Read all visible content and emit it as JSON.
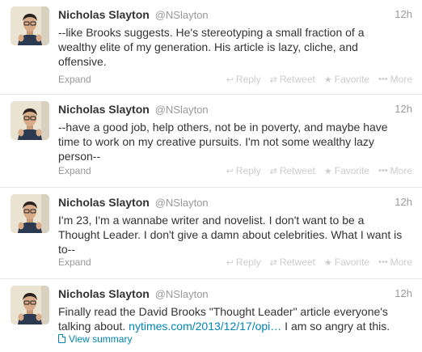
{
  "tweets": [
    {
      "name": "Nicholas Slayton",
      "handle": "@NSlayton",
      "time": "12h",
      "lines": [
        "--like Brooks suggests. He's stereotyping a small fraction of a",
        "wealthy elite of my generation. His article is lazy, cliche, and",
        "offensive."
      ],
      "expand": "Expand"
    },
    {
      "name": "Nicholas Slayton",
      "handle": "@NSlayton",
      "time": "12h",
      "lines": [
        "--have a good job, help others, not be in poverty, and maybe have",
        "time to work on my creative pursuits. I'm not some wealthy lazy",
        "person--"
      ],
      "expand": "Expand"
    },
    {
      "name": "Nicholas Slayton",
      "handle": "@NSlayton",
      "time": "12h",
      "lines": [
        "I'm 23, I'm a wannabe writer and novelist. I don't want to be a",
        "Thought Leader. I don't give a damn about celebrities. What I want is",
        "to--"
      ],
      "expand": "Expand"
    },
    {
      "name": "Nicholas Slayton",
      "handle": "@NSlayton",
      "time": "12h",
      "line1": "Finally read the David Brooks \"Thought Leader\" article everyone's",
      "line2_before": "talking about. ",
      "line2_link": "nytimes.com/2013/12/17/opi…",
      "line2_after": " I am so angry at this.",
      "expand": "View summary"
    }
  ],
  "actions": {
    "reply": "Reply",
    "retweet": "Retweet",
    "favorite": "Favorite",
    "more": "More"
  },
  "icons": {
    "reply": "reply-icon",
    "retweet": "retweet-icon",
    "favorite": "star-icon",
    "more": "more-dots-icon"
  },
  "colors": {
    "link": "#0084b4",
    "muted": "#999999",
    "action": "#cccccc",
    "text": "#333333"
  }
}
